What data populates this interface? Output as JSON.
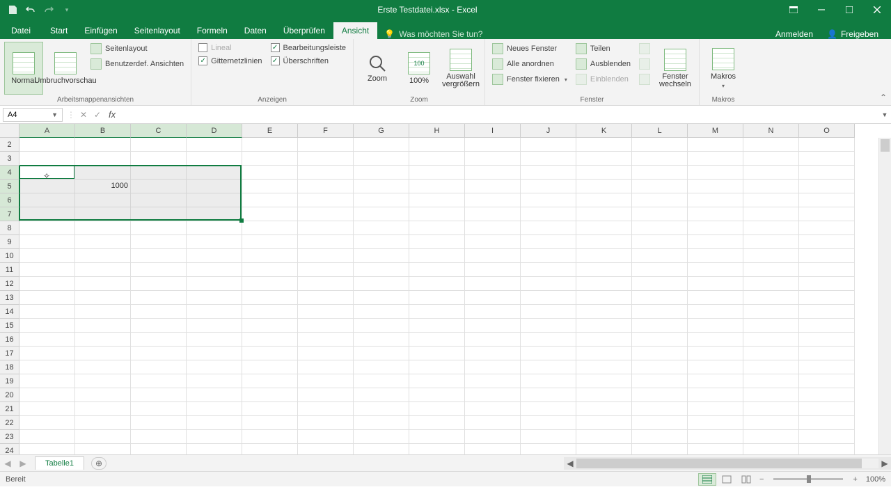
{
  "title": "Erste Testdatei.xlsx - Excel",
  "qat": {
    "save": "save",
    "undo": "undo",
    "redo": "redo"
  },
  "tabs": {
    "datei": "Datei",
    "start": "Start",
    "einfuegen": "Einfügen",
    "seitenlayout": "Seitenlayout",
    "formeln": "Formeln",
    "daten": "Daten",
    "ueberpruefen": "Überprüfen",
    "ansicht": "Ansicht"
  },
  "tellme_placeholder": "Was möchten Sie tun?",
  "signin": "Anmelden",
  "share": "Freigeben",
  "ribbon": {
    "views": {
      "normal": "Normal",
      "umbruch": "Umbruchvorschau",
      "seitenlayout": "Seitenlayout",
      "benutzerdef": "Benutzerdef. Ansichten",
      "group": "Arbeitsmappenansichten"
    },
    "show": {
      "lineal": "Lineal",
      "bearbleiste": "Bearbeitungsleiste",
      "gitter": "Gitternetzlinien",
      "ueberschriften": "Überschriften",
      "group": "Anzeigen"
    },
    "zoom": {
      "zoom": "Zoom",
      "hundert": "100%",
      "auswahl": "Auswahl vergrößern",
      "group": "Zoom"
    },
    "fenster": {
      "neues": "Neues Fenster",
      "anordnen": "Alle anordnen",
      "fixieren": "Fenster fixieren",
      "teilen": "Teilen",
      "ausblenden": "Ausblenden",
      "einblenden": "Einblenden",
      "wechseln": "Fenster wechseln",
      "group": "Fenster"
    },
    "makros": {
      "label": "Makros",
      "group": "Makros"
    }
  },
  "namebox": "A4",
  "columns": [
    "A",
    "B",
    "C",
    "D",
    "E",
    "F",
    "G",
    "H",
    "I",
    "J",
    "K",
    "L",
    "M",
    "N",
    "O"
  ],
  "rows": [
    "2",
    "3",
    "4",
    "5",
    "6",
    "7",
    "8",
    "9",
    "10",
    "11",
    "12",
    "13",
    "14",
    "15",
    "16",
    "17",
    "18",
    "19",
    "20",
    "21",
    "22",
    "23",
    "24"
  ],
  "cellB5": "1000",
  "sheet_tab": "Tabelle1",
  "status": "Bereit",
  "zoom": "100%",
  "selection": {
    "startCol": 0,
    "endCol": 3,
    "startRowIdx": 2,
    "endRowIdx": 5
  }
}
